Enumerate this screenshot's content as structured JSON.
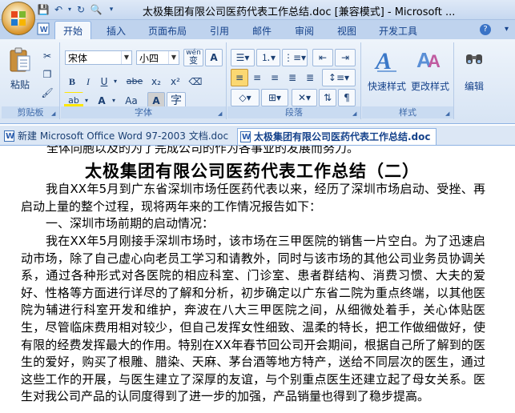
{
  "window": {
    "title": "太极集团有限公司医药代表工作总结.doc [兼容模式] - Microsoft ..."
  },
  "ribbon": {
    "tabs": [
      "开始",
      "插入",
      "页面布局",
      "引用",
      "邮件",
      "审阅",
      "视图",
      "开发工具"
    ],
    "active_tab": "开始",
    "groups": {
      "clipboard": {
        "label": "剪贴板",
        "paste": "粘贴"
      },
      "font": {
        "label": "字体",
        "font_name": "宋体",
        "font_size": "小四",
        "bold": "B",
        "italic": "I",
        "underline": "U",
        "strike": "abe",
        "sub": "x₂",
        "sup": "x²",
        "case": "Aa",
        "highlight": "ab",
        "font_color": "A",
        "char_shade": "A",
        "char_border": "A",
        "phonetic": "wén",
        "enclose": "字"
      },
      "paragraph": {
        "label": "段落"
      },
      "styles": {
        "label": "样式",
        "quick_styles": "快速样式",
        "change_styles": "更改样式"
      },
      "editing": {
        "label": "编辑"
      }
    }
  },
  "doc_tabs": [
    {
      "label": "新建 Microsoft Office Word 97-2003 文档.doc",
      "active": false
    },
    {
      "label": "太极集团有限公司医药代表工作总结.doc",
      "active": true
    }
  ],
  "document": {
    "cutoff_line": "全体同胞以及的为了完成公司的作为各事业的发展而努力。",
    "title": "太极集团有限公司医药代表工作总结（二）",
    "paragraphs": [
      "我自XX年5月到广东省深圳市场任医药代表以来，经历了深圳市场启动、受挫、再启动上量的整个过程，现将两年来的工作情况报告如下：",
      "一、深圳市场前期的启动情况：",
      "我在XX年5月刚接手深圳市场时，该市场在三甲医院的销售一片空白。为了迅速启动市场，除了自己虚心向老员工学习和请教外，同时与该市场的其他公司业务员协调关系，通过各种形式对各医院的相应科室、门诊室、患者群结构、消费习惯、大夫的爱好、性格等方面进行详尽的了解和分析，初步确定以广东省二院为重点终端，以其他医院为辅进行科室开发和维护，奔波在八大三甲医院之间，从细微处着手，关心体贴医生，尽管临床费用相对较少，但自己发挥女性细致、温柔的特长，把工作做细做好，使有限的经费发挥最大的作用。特别在XX年春节回公司开会期间，根据自己所了解到的医生的爱好，购买了根雕、腊染、天麻、茅台酒等地方特产，送给不同层次的医生，通过这些工作的开展，与医生建立了深厚的友谊，与个别重点医生还建立起了母女关系。医生对我公司产品的认同度得到了进一步的加强，产品销量也得到了稳步提高。"
    ]
  }
}
